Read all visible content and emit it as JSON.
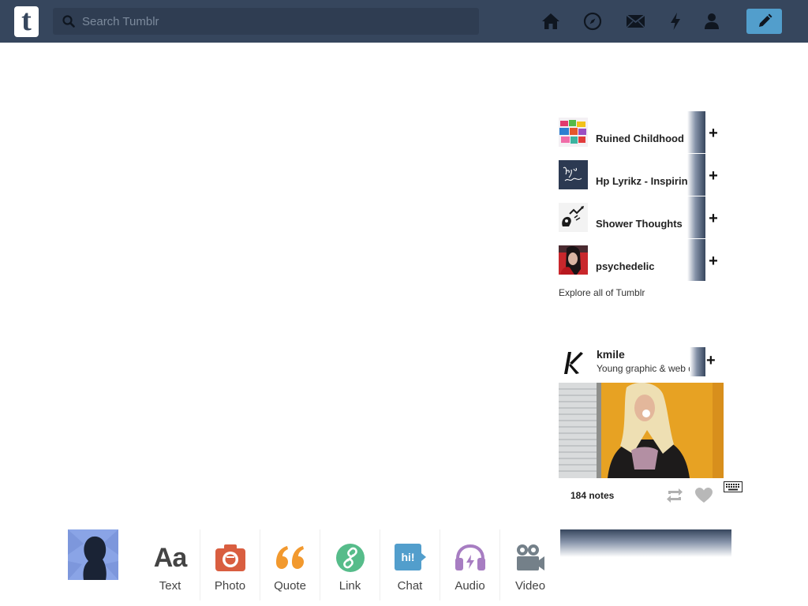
{
  "header": {
    "logo_letter": "t",
    "search_placeholder": "Search Tumblr",
    "nav_icons": [
      "home-icon",
      "explore-compass-icon",
      "inbox-mail-icon",
      "activity-lightning-icon",
      "account-person-icon"
    ],
    "compose_icon": "pencil-icon"
  },
  "recommended": {
    "items": [
      {
        "name": "Ruined Childhood",
        "follow": "+"
      },
      {
        "name": "Hp Lyrikz - Inspiring",
        "follow": "+"
      },
      {
        "name": "Shower Thoughts",
        "follow": "+"
      },
      {
        "name": "psychedelic",
        "follow": "+"
      }
    ],
    "explore_link": "Explore all of Tumblr"
  },
  "radar": {
    "name": "kmile",
    "description": "Young graphic & web designer",
    "follow": "+",
    "notes": "184 notes"
  },
  "post_types": [
    {
      "label": "Text",
      "icon": "text-aa-icon",
      "color": "#444444"
    },
    {
      "label": "Photo",
      "icon": "camera-icon",
      "color": "#d95e40"
    },
    {
      "label": "Quote",
      "icon": "quote-icon",
      "color": "#f2992e"
    },
    {
      "label": "Link",
      "icon": "link-icon",
      "color": "#56bc8a"
    },
    {
      "label": "Chat",
      "icon": "chat-bubble-icon",
      "color": "#529ecc"
    },
    {
      "label": "Audio",
      "icon": "headphones-icon",
      "color": "#a77dc2"
    },
    {
      "label": "Video",
      "icon": "video-camera-icon",
      "color": "#748089"
    }
  ],
  "colors": {
    "header_bg": "#36465d",
    "accent": "#529ecc"
  }
}
